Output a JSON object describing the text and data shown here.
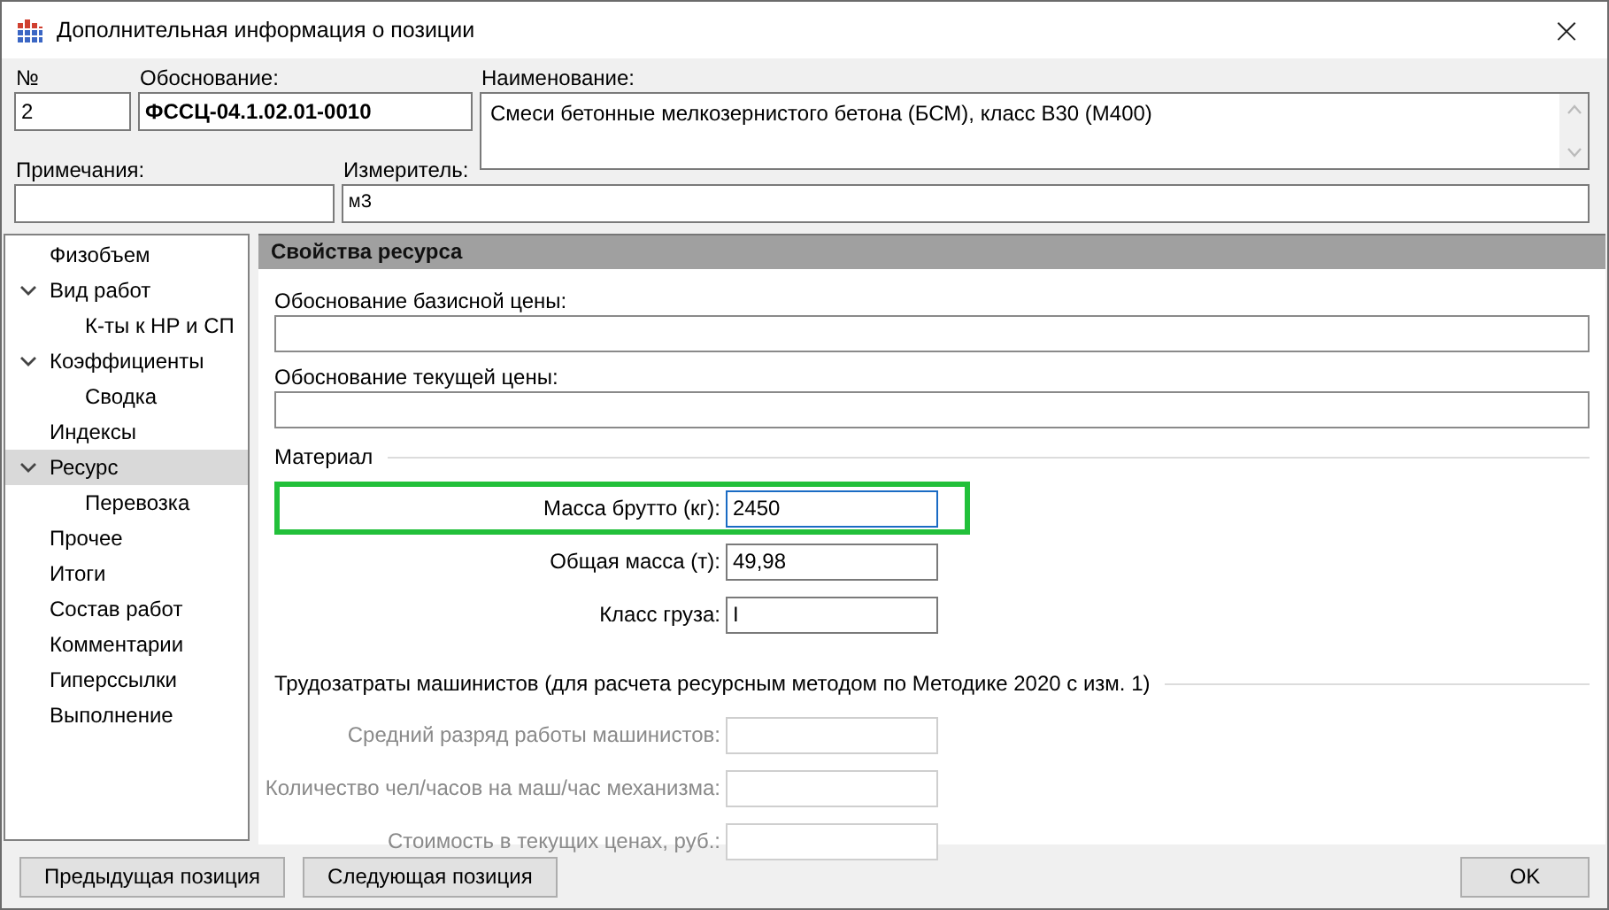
{
  "window": {
    "title": "Дополнительная информация о позиции",
    "close": "×"
  },
  "header_fields": {
    "number": {
      "label": "№",
      "value": "2"
    },
    "basis": {
      "label": "Обоснование:",
      "value": "ФССЦ-04.1.02.01-0010"
    },
    "name": {
      "label": "Наименование:",
      "value": "Смеси бетонные мелкозернистого бетона (БСМ), класс В30 (М400)"
    },
    "notes": {
      "label": "Примечания:"
    },
    "unit": {
      "label": "Измеритель:",
      "value": "м3"
    }
  },
  "sidebar": {
    "items": [
      {
        "label": "Физобъем",
        "selected": false
      },
      {
        "label": "Вид работ",
        "selected": false,
        "expanded": true,
        "children": [
          {
            "label": "К-ты к НР и СП",
            "selected": false
          }
        ]
      },
      {
        "label": "Коэффициенты",
        "selected": false,
        "expanded": true,
        "children": [
          {
            "label": "Сводка",
            "selected": false
          }
        ]
      },
      {
        "label": "Индексы",
        "selected": false
      },
      {
        "label": "Ресурс",
        "selected": true,
        "expanded": true,
        "children": [
          {
            "label": "Перевозка",
            "selected": false
          }
        ]
      },
      {
        "label": "Прочее",
        "selected": false
      },
      {
        "label": "Итоги",
        "selected": false
      },
      {
        "label": "Состав работ",
        "selected": false
      },
      {
        "label": "Комментарии",
        "selected": false
      },
      {
        "label": "Гиперссылки",
        "selected": false
      },
      {
        "label": "Выполнение",
        "selected": false
      }
    ]
  },
  "panel": {
    "title": "Свойства ресурса",
    "price_fields": [
      {
        "label": "Обоснование базисной цены:"
      },
      {
        "label": "Обоснование текущей цены:"
      }
    ],
    "groups": [
      {
        "title": "Материал",
        "fields": [
          {
            "label": "Масса брутто (кг):",
            "value": "2450",
            "disabled": false,
            "highlighted": true,
            "focused": true
          },
          {
            "label": "Общая масса (т):",
            "value": "49,98",
            "disabled": false,
            "highlighted": false,
            "focused": false
          },
          {
            "label": "Класс груза:",
            "value": "I",
            "disabled": false,
            "highlighted": false,
            "focused": false
          }
        ]
      },
      {
        "title": "Трудозатраты машинистов (для расчета ресурсным методом по Методике 2020 с изм. 1)",
        "fields": [
          {
            "label": "Средний разряд работы машинистов:",
            "disabled": true,
            "highlighted": false,
            "focused": false
          },
          {
            "label": "Количество чел/часов на маш/час механизма:",
            "disabled": true,
            "highlighted": false,
            "focused": false
          },
          {
            "label": "Стоимость в текущих ценах, руб.:",
            "disabled": true,
            "highlighted": false,
            "focused": false
          }
        ]
      }
    ]
  },
  "buttons": {
    "left": [
      "Предыдущая позиция",
      "Следующая позиция"
    ],
    "right": [
      "OK"
    ]
  }
}
